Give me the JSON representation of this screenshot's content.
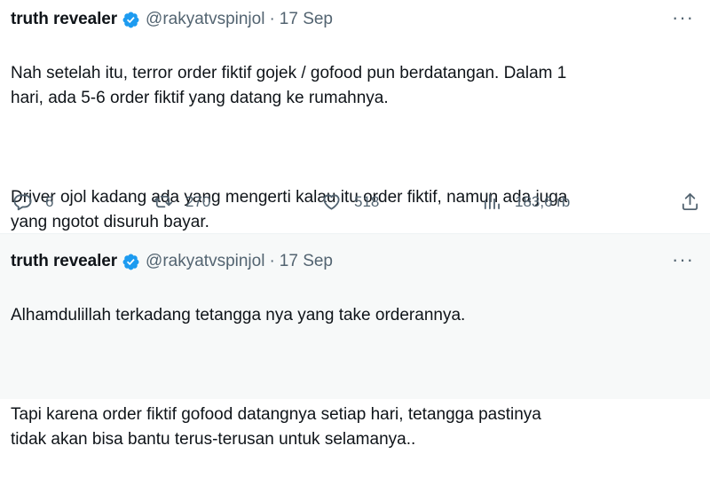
{
  "tweets": [
    {
      "name": "truth revealer",
      "handle": "@rakyatvspinjol",
      "sep": "·",
      "date": "17 Sep",
      "more": "···",
      "paragraphs": [
        "Nah setelah itu, terror order fiktif gojek / gofood pun berdatangan. Dalam 1\nhari, ada 5-6 order fiktif yang datang ke rumahnya.",
        "Driver ojol kadang ada yang mengerti kalau itu order fiktif, namun ada juga\nyang ngotot disuruh bayar."
      ],
      "actions": {
        "replies": "6",
        "retweets": "270",
        "likes": "518",
        "views": "183,6 rb"
      }
    },
    {
      "name": "truth revealer",
      "handle": "@rakyatvspinjol",
      "sep": "·",
      "date": "17 Sep",
      "more": "···",
      "paragraphs": [
        "Alhamdulillah terkadang tetangga nya yang take orderannya.",
        "Tapi karena order fiktif gofood datangnya setiap hari, tetangga pastinya\ntidak akan bisa bantu terus-terusan untuk selamanya.."
      ]
    }
  ],
  "colors": {
    "verified": "#1d9bf0",
    "secondary_text": "#536471",
    "primary_text": "#0f1419"
  },
  "icons": {
    "verified": "verified-badge-icon",
    "reply": "reply-icon",
    "retweet": "retweet-icon",
    "like": "heart-icon",
    "views": "views-icon",
    "share": "share-icon"
  }
}
